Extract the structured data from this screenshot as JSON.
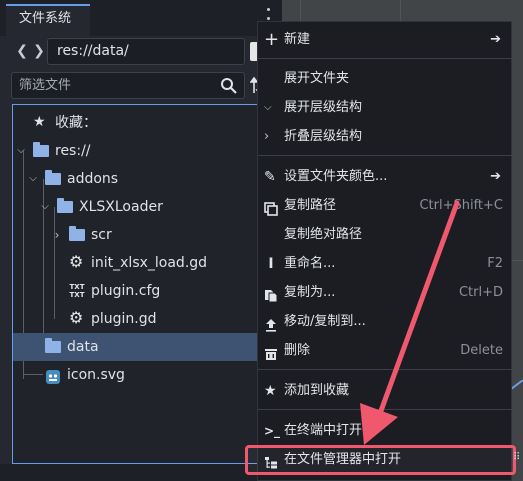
{
  "dock": {
    "tab_title": "文件系统",
    "path": "res://data/",
    "filter_placeholder": "筛选文件",
    "nav_back": "❮",
    "nav_forward": "❯"
  },
  "tree": {
    "favorites": "收藏：",
    "items": [
      {
        "label": "res://",
        "type": "folder"
      },
      {
        "label": "addons",
        "type": "folder"
      },
      {
        "label": "XLSXLoader",
        "type": "folder"
      },
      {
        "label": "scr",
        "type": "folder"
      },
      {
        "label": "init_xlsx_load.gd",
        "type": "gear"
      },
      {
        "label": "plugin.cfg",
        "type": "txt"
      },
      {
        "label": "plugin.gd",
        "type": "gear"
      },
      {
        "label": "data",
        "type": "folder",
        "selected": true
      },
      {
        "label": "icon.svg",
        "type": "image"
      }
    ]
  },
  "menu": {
    "items": [
      {
        "label": "新建",
        "shortcut": "",
        "icon": "plus-icon",
        "submenu": true
      },
      {
        "label": "展开文件夹",
        "shortcut": "",
        "icon": "",
        "submenu": false
      },
      {
        "label": "展开层级结构",
        "shortcut": "",
        "icon": "chevron-down-icon",
        "submenu": false
      },
      {
        "label": "折叠层级结构",
        "shortcut": "",
        "icon": "chevron-right-icon",
        "submenu": false
      },
      {
        "label": "设置文件夹颜色...",
        "shortcut": "",
        "icon": "brush-icon",
        "submenu": true
      },
      {
        "label": "复制路径",
        "shortcut": "Ctrl+Shift+C",
        "icon": "copy-icon",
        "submenu": false
      },
      {
        "label": "复制绝对路径",
        "shortcut": "",
        "icon": "",
        "submenu": false
      },
      {
        "label": "重命名...",
        "shortcut": "F2",
        "icon": "text-cursor-icon",
        "submenu": false
      },
      {
        "label": "复制为...",
        "shortcut": "Ctrl+D",
        "icon": "duplicate-icon",
        "submenu": false
      },
      {
        "label": "移动/复制到...",
        "shortcut": "",
        "icon": "move-icon",
        "submenu": false
      },
      {
        "label": "删除",
        "shortcut": "Delete",
        "icon": "trash-icon",
        "submenu": false
      },
      {
        "label": "添加到收藏",
        "shortcut": "",
        "icon": "star-icon",
        "submenu": false
      },
      {
        "label": "在终端中打开",
        "shortcut": "",
        "icon": "terminal-icon",
        "submenu": false
      },
      {
        "label": "在文件管理器中打开",
        "shortcut": "",
        "icon": "filesystem-icon",
        "submenu": false
      }
    ]
  },
  "colors": {
    "accent": "#699ce8",
    "highlight": "#f0586e",
    "folder": "#8fb3e6"
  }
}
